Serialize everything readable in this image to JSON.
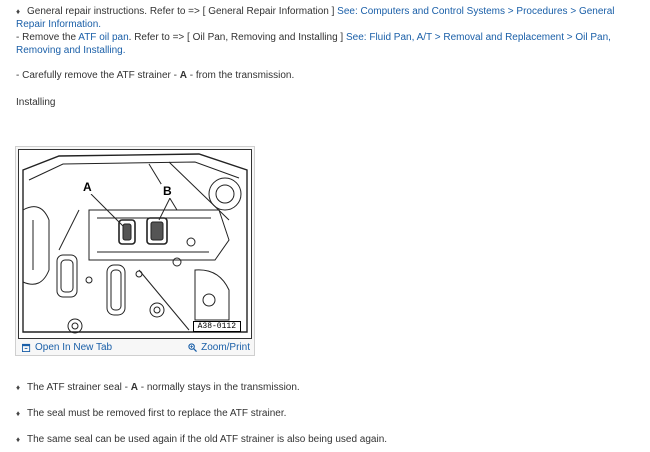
{
  "intro": {
    "bullet_glyph": "♦",
    "general_text": "General repair instructions. Refer to => [ General Repair Information ] ",
    "general_link": "See: Computers and Control Systems > Procedures > General Repair Information.",
    "remove_prefix": "- ",
    "remove_before": "Remove the ",
    "remove_link1": "ATF oil pan",
    "remove_middle": ". Refer to => [ Oil Pan, Removing and Installing ] ",
    "remove_link2": "See: Fluid Pan, A/T > Removal and Replacement > Oil Pan, Removing and Installing.",
    "strainer_prefix": "- ",
    "strainer_before": "Carefully remove the ATF strainer - ",
    "strainer_bold": "A",
    "strainer_after": " - from the transmission.",
    "heading": "Installing"
  },
  "figure": {
    "label_a": "A",
    "label_b": "B",
    "figure_id": "A38-0112",
    "open_label": "Open In New Tab",
    "zoom_label": "Zoom/Print",
    "open_icon": "open-in-new-tab-icon",
    "zoom_icon": "magnifier-plus-icon"
  },
  "notes": [
    {
      "before": "The ATF strainer seal - ",
      "bold": "A",
      "after": " - normally stays in the transmission."
    },
    {
      "before": "The seal must be removed first to replace the ATF strainer.",
      "bold": "",
      "after": ""
    },
    {
      "before": "The same seal can be used again if the old ATF strainer is also being used again.",
      "bold": "",
      "after": ""
    }
  ],
  "colors": {
    "link": "#1a5fa8",
    "text": "#333333"
  }
}
